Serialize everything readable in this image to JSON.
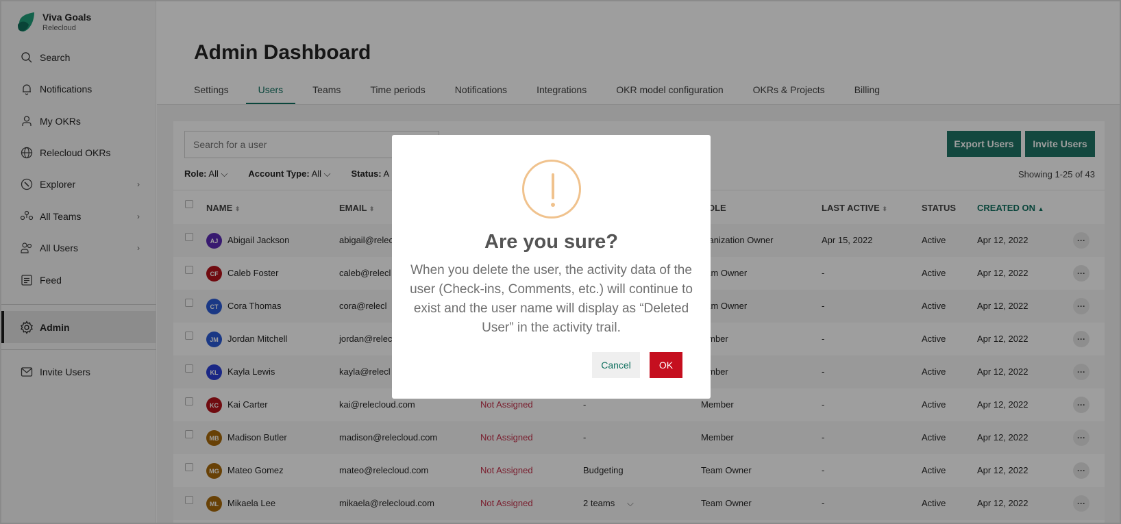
{
  "app": {
    "name": "Viva Goals",
    "org": "Relecloud"
  },
  "sidebar": {
    "items": [
      {
        "label": "Search"
      },
      {
        "label": "Notifications"
      },
      {
        "label": "My OKRs"
      },
      {
        "label": "Relecloud OKRs"
      },
      {
        "label": "Explorer"
      },
      {
        "label": "All Teams"
      },
      {
        "label": "All Users"
      },
      {
        "label": "Feed"
      },
      {
        "label": "Admin"
      },
      {
        "label": "Invite Users"
      }
    ]
  },
  "page": {
    "title": "Admin Dashboard"
  },
  "tabs": [
    {
      "label": "Settings"
    },
    {
      "label": "Users"
    },
    {
      "label": "Teams"
    },
    {
      "label": "Time periods"
    },
    {
      "label": "Notifications"
    },
    {
      "label": "Integrations"
    },
    {
      "label": "OKR model configuration"
    },
    {
      "label": "OKRs & Projects"
    },
    {
      "label": "Billing"
    }
  ],
  "toolbar": {
    "search_placeholder": "Search for a user",
    "export_label": "Export Users",
    "invite_label": "Invite Users",
    "filters": [
      {
        "name": "Role:",
        "value": "All"
      },
      {
        "name": "Account Type:",
        "value": "All"
      },
      {
        "name": "Status:",
        "value": "A"
      }
    ],
    "showing": "Showing 1-25 of 43"
  },
  "table": {
    "headers": {
      "name": "NAME",
      "email": "EMAIL",
      "role": "OLE",
      "last_active": "LAST ACTIVE",
      "status": "STATUS",
      "created_on": "CREATED ON"
    },
    "rows": [
      {
        "initials": "AJ",
        "color": "#5b2bb5",
        "name": "Abigail Jackson",
        "email": "abigail@relecl",
        "account": "",
        "teams": "",
        "role": "rganization Owner",
        "last_active": "Apr 15, 2022",
        "status": "Active",
        "created": "Apr 12, 2022"
      },
      {
        "initials": "CF",
        "color": "#b5121b",
        "name": "Caleb Foster",
        "email": "caleb@relecl",
        "account": "",
        "teams": "",
        "role": "eam Owner",
        "last_active": "-",
        "status": "Active",
        "created": "Apr 12, 2022"
      },
      {
        "initials": "CT",
        "color": "#2a5bd7",
        "name": "Cora Thomas",
        "email": "cora@relecl",
        "account": "",
        "teams": "",
        "role": "eam Owner",
        "last_active": "-",
        "status": "Active",
        "created": "Apr 12, 2022"
      },
      {
        "initials": "JM",
        "color": "#2a5bd7",
        "name": "Jordan Mitchell",
        "email": "jordan@relec",
        "account": "",
        "teams": "",
        "role": "lember",
        "last_active": "-",
        "status": "Active",
        "created": "Apr 12, 2022"
      },
      {
        "initials": "KL",
        "color": "#2a3fd7",
        "name": "Kayla Lewis",
        "email": "kayla@relecl",
        "account": "",
        "teams": "",
        "role": "lember",
        "last_active": "-",
        "status": "Active",
        "created": "Apr 12, 2022"
      },
      {
        "initials": "KC",
        "color": "#b5121b",
        "name": "Kai Carter",
        "email": "kai@relecloud.com",
        "account": "Not Assigned",
        "teams": "-",
        "role": "Member",
        "last_active": "-",
        "status": "Active",
        "created": "Apr 12, 2022"
      },
      {
        "initials": "MB",
        "color": "#a8690a",
        "name": "Madison Butler",
        "email": "madison@relecloud.com",
        "account": "Not Assigned",
        "teams": "-",
        "role": "Member",
        "last_active": "-",
        "status": "Active",
        "created": "Apr 12, 2022"
      },
      {
        "initials": "MG",
        "color": "#a8690a",
        "name": "Mateo Gomez",
        "email": "mateo@relecloud.com",
        "account": "Not Assigned",
        "teams": "Budgeting",
        "role": "Team Owner",
        "last_active": "-",
        "status": "Active",
        "created": "Apr 12, 2022"
      },
      {
        "initials": "ML",
        "color": "#a8690a",
        "name": "Mikaela Lee",
        "email": "mikaela@relecloud.com",
        "account": "Not Assigned",
        "teams": "2 teams",
        "role": "Team Owner",
        "last_active": "-",
        "status": "Active",
        "created": "Apr 12, 2022"
      }
    ]
  },
  "modal": {
    "title": "Are you sure?",
    "text": "When you delete the user, the activity data of the user (Check-ins, Comments, etc.) will continue to exist and the user name will display as “Deleted User” in the activity trail.",
    "cancel_label": "Cancel",
    "ok_label": "OK"
  },
  "colors": {
    "accent": "#207566",
    "danger": "#c50f1f",
    "warning": "#f0c28d"
  }
}
